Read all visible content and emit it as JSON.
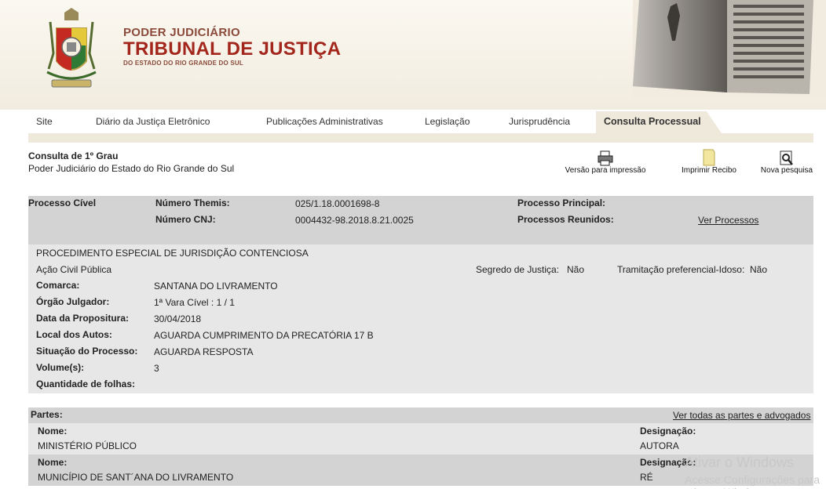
{
  "brand": {
    "line1": "PODER JUDICIÁRIO",
    "line2": "TRIBUNAL DE JUSTIÇA",
    "line3": "DO ESTADO DO RIO GRANDE DO SUL"
  },
  "tabs": [
    "Site",
    "Diário da Justiça Eletrônico",
    "Publicações Administrativas",
    "Legislação",
    "Jurisprudência",
    "Consulta Processual"
  ],
  "subheader": {
    "title": "Consulta de 1º Grau",
    "subtitle": "Poder Judiciário do Estado do Rio Grande do Sul"
  },
  "tools": {
    "print": "Versão para impressão",
    "receipt": "Imprimir Recibo",
    "search": "Nova pesquisa"
  },
  "process": {
    "type": "Processo Cível",
    "themis_label": "Número Themis:",
    "themis_value": "025/1.18.0001698-8",
    "cnj_label": "Número CNJ:",
    "cnj_value": "0004432-98.2018.8.21.0025",
    "principal_label": "Processo Principal:",
    "reunidos_label": "Processos Reunidos:",
    "reunidos_link": "Ver Processos",
    "procedure": "PROCEDIMENTO ESPECIAL DE JURISDIÇÃO CONTENCIOSA",
    "action": "Ação Civil Pública",
    "segredo_label": "Segredo de Justiça:",
    "segredo_value": "Não",
    "tramitacao_label": "Tramitação preferencial-Idoso:",
    "tramitacao_value": "Não",
    "fields": [
      {
        "label": "Comarca:",
        "value": "SANTANA DO LIVRAMENTO"
      },
      {
        "label": "Órgão Julgador:",
        "value": "1ª Vara Cível : 1 / 1"
      },
      {
        "label": "Data da Propositura:",
        "value": "30/04/2018"
      },
      {
        "label": "Local dos Autos:",
        "value": "AGUARDA CUMPRIMENTO DA PRECATÓRIA 17 B"
      },
      {
        "label": "Situação do Processo:",
        "value": "AGUARDA RESPOSTA"
      },
      {
        "label": "Volume(s):",
        "value": "3"
      },
      {
        "label": "Quantidade de folhas:",
        "value": ""
      }
    ]
  },
  "partes": {
    "title": "Partes:",
    "link": "Ver todas as partes e advogados",
    "name_label": "Nome:",
    "designation_label": "Designação:",
    "rows": [
      {
        "name": "MINISTÉRIO PÚBLICO",
        "designation": "AUTORA"
      },
      {
        "name": "MUNICÍPIO DE SANT´ANA DO LIVRAMENTO",
        "designation": "RÉ"
      }
    ]
  },
  "watermark": {
    "line1": "Ativar o Windows",
    "line2": "Acesse Configurações para ativar o Windows."
  },
  "colors": {
    "brand_red": "#a3261c",
    "tab_active": "#efe9db",
    "box_dark": "#d3d3d3",
    "box_light": "#e7e7e7"
  }
}
